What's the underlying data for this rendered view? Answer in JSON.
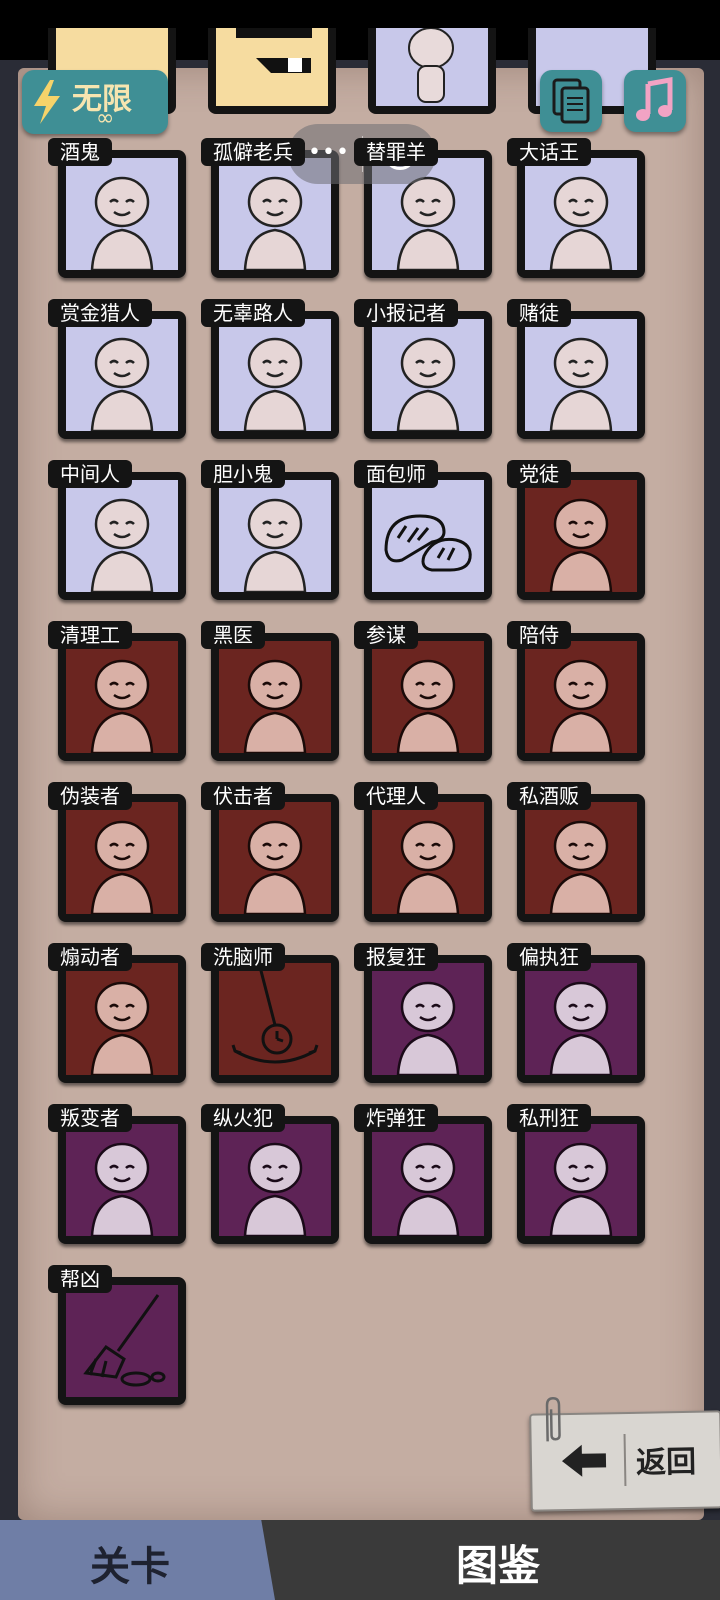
{
  "top_bar": {
    "energy_label": "无限",
    "energy_value": "∞"
  },
  "capsule": {
    "dots": "•••"
  },
  "grid": [
    {
      "label": "酒鬼",
      "theme": "good",
      "icon": "drunkard-art-icon"
    },
    {
      "label": "孤僻老兵",
      "theme": "good",
      "icon": "veteran-art-icon"
    },
    {
      "label": "替罪羊",
      "theme": "good",
      "icon": "scapegoat-art-icon"
    },
    {
      "label": "大话王",
      "theme": "good",
      "icon": "boaster-art-icon"
    },
    {
      "label": "赏金猎人",
      "theme": "good",
      "icon": "bounty-hunter-art-icon"
    },
    {
      "label": "无辜路人",
      "theme": "good",
      "icon": "bystander-art-icon"
    },
    {
      "label": "小报记者",
      "theme": "good",
      "icon": "reporter-art-icon"
    },
    {
      "label": "赌徒",
      "theme": "good",
      "icon": "gambler-art-icon"
    },
    {
      "label": "中间人",
      "theme": "good",
      "icon": "middleman-art-icon"
    },
    {
      "label": "胆小鬼",
      "theme": "good",
      "icon": "coward-art-icon"
    },
    {
      "label": "面包师",
      "theme": "good",
      "icon": "baker-art-icon"
    },
    {
      "label": "党徒",
      "theme": "bad",
      "icon": "gangster-art-icon"
    },
    {
      "label": "清理工",
      "theme": "bad",
      "icon": "cleaner-art-icon"
    },
    {
      "label": "黑医",
      "theme": "bad",
      "icon": "black-doctor-art-icon"
    },
    {
      "label": "参谋",
      "theme": "bad",
      "icon": "advisor-art-icon"
    },
    {
      "label": "陪侍",
      "theme": "bad",
      "icon": "escort-art-icon"
    },
    {
      "label": "伪装者",
      "theme": "bad",
      "icon": "disguiser-art-icon"
    },
    {
      "label": "伏击者",
      "theme": "bad",
      "icon": "ambusher-art-icon"
    },
    {
      "label": "代理人",
      "theme": "bad",
      "icon": "agent-art-icon"
    },
    {
      "label": "私酒贩",
      "theme": "bad",
      "icon": "bootlegger-art-icon"
    },
    {
      "label": "煽动者",
      "theme": "bad",
      "icon": "agitator-art-icon"
    },
    {
      "label": "洗脑师",
      "theme": "bad",
      "icon": "brainwasher-art-icon"
    },
    {
      "label": "报复狂",
      "theme": "evil",
      "icon": "avenger-art-icon"
    },
    {
      "label": "偏执狂",
      "theme": "evil",
      "icon": "paranoiac-art-icon"
    },
    {
      "label": "叛变者",
      "theme": "evil",
      "icon": "traitor-art-icon"
    },
    {
      "label": "纵火犯",
      "theme": "evil",
      "icon": "arsonist-art-icon"
    },
    {
      "label": "炸弹狂",
      "theme": "evil",
      "icon": "bomber-art-icon"
    },
    {
      "label": "私刑狂",
      "theme": "evil",
      "icon": "lyncher-art-icon"
    },
    {
      "label": "帮凶",
      "theme": "evil",
      "icon": "accomplice-art-icon"
    }
  ],
  "back_button": {
    "label": "返回"
  },
  "tabs": [
    {
      "label": "关卡"
    },
    {
      "label": "图鉴"
    }
  ],
  "colors": {
    "good": "#c8c8ea",
    "bad": "#6b2520",
    "evil": "#5e2356",
    "paper": "#c4ada2",
    "tab_active": "#6f7ea6"
  }
}
